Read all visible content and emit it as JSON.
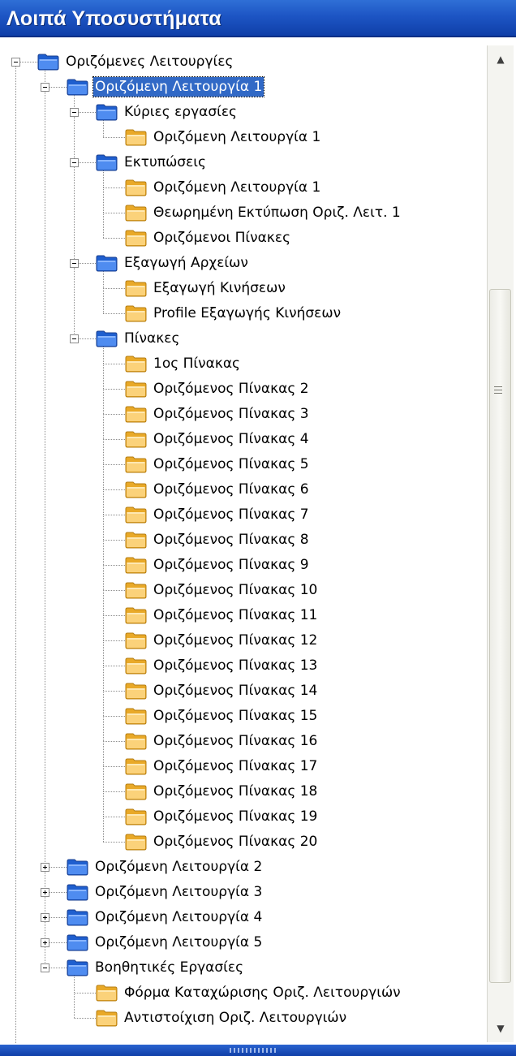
{
  "window": {
    "title": "Λοιπά Υποσυστήματα"
  },
  "tree": [
    {
      "label": "Οριζόμενες Λειτουργίες",
      "level": 0,
      "icon": "blue-folder-icon",
      "expander": "minus",
      "selected": false
    },
    {
      "label": "Οριζόμενη Λειτουργία 1",
      "level": 1,
      "icon": "blue-folder-icon",
      "expander": "minus",
      "selected": true
    },
    {
      "label": "Κύριες εργασίες",
      "level": 2,
      "icon": "blue-folder-icon",
      "expander": "minus",
      "selected": false
    },
    {
      "label": "Οριζόμενη Λειτουργία 1",
      "level": 3,
      "icon": "yellow-folder-icon",
      "expander": "none",
      "selected": false
    },
    {
      "label": "Εκτυπώσεις",
      "level": 2,
      "icon": "blue-folder-icon",
      "expander": "minus",
      "selected": false
    },
    {
      "label": "Οριζόμενη Λειτουργία 1",
      "level": 3,
      "icon": "yellow-folder-icon",
      "expander": "none",
      "selected": false
    },
    {
      "label": "Θεωρημένη Εκτύπωση Οριζ. Λειτ. 1",
      "level": 3,
      "icon": "yellow-folder-icon",
      "expander": "none",
      "selected": false
    },
    {
      "label": "Οριζόμενοι Πίνακες",
      "level": 3,
      "icon": "yellow-folder-icon",
      "expander": "none",
      "selected": false
    },
    {
      "label": "Εξαγωγή Αρχείων",
      "level": 2,
      "icon": "blue-folder-icon",
      "expander": "minus",
      "selected": false
    },
    {
      "label": "Εξαγωγή Κινήσεων",
      "level": 3,
      "icon": "yellow-folder-icon",
      "expander": "none",
      "selected": false
    },
    {
      "label": "Profile Εξαγωγής Κινήσεων",
      "level": 3,
      "icon": "yellow-folder-icon",
      "expander": "none",
      "selected": false
    },
    {
      "label": "Πίνακες",
      "level": 2,
      "icon": "blue-folder-icon",
      "expander": "minus",
      "selected": false
    },
    {
      "label": "1ος Πίνακας",
      "level": 3,
      "icon": "yellow-folder-icon",
      "expander": "none",
      "selected": false
    },
    {
      "label": "Οριζόμενος Πίνακας 2",
      "level": 3,
      "icon": "yellow-folder-icon",
      "expander": "none",
      "selected": false
    },
    {
      "label": "Οριζόμενος Πίνακας 3",
      "level": 3,
      "icon": "yellow-folder-icon",
      "expander": "none",
      "selected": false
    },
    {
      "label": "Οριζόμενος Πίνακας 4",
      "level": 3,
      "icon": "yellow-folder-icon",
      "expander": "none",
      "selected": false
    },
    {
      "label": "Οριζόμενος Πίνακας 5",
      "level": 3,
      "icon": "yellow-folder-icon",
      "expander": "none",
      "selected": false
    },
    {
      "label": "Οριζόμενος Πίνακας 6",
      "level": 3,
      "icon": "yellow-folder-icon",
      "expander": "none",
      "selected": false
    },
    {
      "label": "Οριζόμενος Πίνακας 7",
      "level": 3,
      "icon": "yellow-folder-icon",
      "expander": "none",
      "selected": false
    },
    {
      "label": "Οριζόμενος Πίνακας 8",
      "level": 3,
      "icon": "yellow-folder-icon",
      "expander": "none",
      "selected": false
    },
    {
      "label": "Οριζόμενος Πίνακας 9",
      "level": 3,
      "icon": "yellow-folder-icon",
      "expander": "none",
      "selected": false
    },
    {
      "label": "Οριζόμενος Πίνακας 10",
      "level": 3,
      "icon": "yellow-folder-icon",
      "expander": "none",
      "selected": false
    },
    {
      "label": "Οριζόμενος Πίνακας 11",
      "level": 3,
      "icon": "yellow-folder-icon",
      "expander": "none",
      "selected": false
    },
    {
      "label": "Οριζόμενος Πίνακας 12",
      "level": 3,
      "icon": "yellow-folder-icon",
      "expander": "none",
      "selected": false
    },
    {
      "label": "Οριζόμενος Πίνακας 13",
      "level": 3,
      "icon": "yellow-folder-icon",
      "expander": "none",
      "selected": false
    },
    {
      "label": "Οριζόμενος Πίνακας 14",
      "level": 3,
      "icon": "yellow-folder-icon",
      "expander": "none",
      "selected": false
    },
    {
      "label": "Οριζόμενος Πίνακας 15",
      "level": 3,
      "icon": "yellow-folder-icon",
      "expander": "none",
      "selected": false
    },
    {
      "label": "Οριζόμενος Πίνακας 16",
      "level": 3,
      "icon": "yellow-folder-icon",
      "expander": "none",
      "selected": false
    },
    {
      "label": "Οριζόμενος Πίνακας 17",
      "level": 3,
      "icon": "yellow-folder-icon",
      "expander": "none",
      "selected": false
    },
    {
      "label": "Οριζόμενος Πίνακας 18",
      "level": 3,
      "icon": "yellow-folder-icon",
      "expander": "none",
      "selected": false
    },
    {
      "label": "Οριζόμενος Πίνακας 19",
      "level": 3,
      "icon": "yellow-folder-icon",
      "expander": "none",
      "selected": false
    },
    {
      "label": "Οριζόμενος Πίνακας 20",
      "level": 3,
      "icon": "yellow-folder-icon",
      "expander": "none",
      "selected": false
    },
    {
      "label": "Οριζόμενη Λειτουργία 2",
      "level": 1,
      "icon": "blue-folder-icon",
      "expander": "plus",
      "selected": false
    },
    {
      "label": "Οριζόμενη Λειτουργία 3",
      "level": 1,
      "icon": "blue-folder-icon",
      "expander": "plus",
      "selected": false
    },
    {
      "label": "Οριζόμενη Λειτουργία 4",
      "level": 1,
      "icon": "blue-folder-icon",
      "expander": "plus",
      "selected": false
    },
    {
      "label": "Οριζόμενη Λειτουργία 5",
      "level": 1,
      "icon": "blue-folder-icon",
      "expander": "plus",
      "selected": false
    },
    {
      "label": "Βοηθητικές Εργασίες",
      "level": 1,
      "icon": "blue-folder-icon",
      "expander": "minus",
      "selected": false
    },
    {
      "label": "Φόρμα Καταχώρισης Οριζ. Λειτουργιών",
      "level": 2,
      "icon": "yellow-folder-icon",
      "expander": "none",
      "selected": false
    },
    {
      "label": "Αντιστοίχιση Οριζ. Λειτουργιών",
      "level": 2,
      "icon": "yellow-folder-icon",
      "expander": "none",
      "selected": false
    }
  ],
  "scrollbar": {
    "up_icon": "arrow-up-icon",
    "down_icon": "arrow-down-icon",
    "grip_icon": "grip-icon"
  },
  "colors": {
    "title_bar": "#1d55c4",
    "selection": "#3169c6",
    "blue_folder": "#2f73e0",
    "yellow_folder": "#f6c454"
  }
}
